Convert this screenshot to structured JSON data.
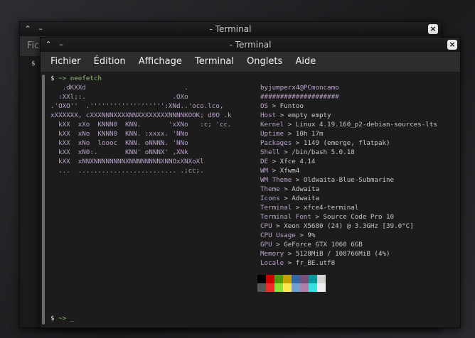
{
  "back_window": {
    "title": "- Terminal",
    "menu_partial": "Fic",
    "prompt_partial": "$"
  },
  "front_window": {
    "title": "- Terminal",
    "menu": [
      "Fichier",
      "Édition",
      "Affichage",
      "Terminal",
      "Onglets",
      "Aide"
    ],
    "prompt_symbol": "$",
    "prompt_arrow": "~>",
    "command": "neofetch",
    "final_prompt": "~> _"
  },
  "logo_lines": [
    "   .dKXXd                         .",
    "  :XXl;:.                      .OXo",
    ".'OXO''  .''''''''''''''''''':XNd..'oco.lco,",
    "xXXXXXX, cXXXNNNXXXXNNXXXXXXXXNNNNKOOK; d0O .k",
    "  kXX  xXo  KNNN0  KNN.       'xXNo   :c; 'cc.",
    "  kXX  xNo  KNNN0  KNN. :xxxx. 'NNo",
    "  kXX  xNo  loooc  KNN. oNNNN. 'NNo",
    "  kXX  xN0:.       KNN' oNNNX' ,XNk",
    "  kXX  xNNXNNNNNNNNXNNNNNNNNXNNOxXNXoXl",
    "  ...  ......................... .;cc;."
  ],
  "sysinfo": {
    "user_host": "byjumperx4@PCmoncamo",
    "separator": "####################",
    "rows": [
      {
        "key": "OS",
        "val": "Funtoo"
      },
      {
        "key": "Host",
        "val": "empty empty"
      },
      {
        "key": "Kernel",
        "val": "Linux 4.19.160_p2-debian-sources-lts"
      },
      {
        "key": "Uptime",
        "val": "10h 17m"
      },
      {
        "key": "Packages",
        "val": "1149 (emerge, flatpak)"
      },
      {
        "key": "Shell",
        "val": "/bin/bash 5.0.18"
      },
      {
        "key": "DE",
        "val": "Xfce 4.14"
      },
      {
        "key": "WM",
        "val": "Xfwm4"
      },
      {
        "key": "WM Theme",
        "val": "Oldwaita-Blue-Submarine"
      },
      {
        "key": "Theme",
        "val": "Adwaita"
      },
      {
        "key": "Icons",
        "val": "Adwaita"
      },
      {
        "key": "Terminal",
        "val": "xfce4-terminal"
      },
      {
        "key": "Terminal Font",
        "val": "Source Code Pro 10"
      },
      {
        "key": "CPU",
        "val": "Xeon X5680 (24) @ 3.3GHz [39.0°C]"
      },
      {
        "key": "CPU Usage",
        "val": "9%"
      },
      {
        "key": "GPU",
        "val": "GeForce GTX 1060 6GB"
      },
      {
        "key": "Memory",
        "val": "5128MiB / 108766MiB (4%)"
      },
      {
        "key": "Locale",
        "val": "fr_BE.utf8"
      }
    ],
    "row_sep": " > "
  },
  "colors": {
    "row1": [
      "#000000",
      "#cc0000",
      "#4e9a06",
      "#c4a000",
      "#3465a4",
      "#75507b",
      "#06989a",
      "#d3d7cf"
    ],
    "row2": [
      "#555753",
      "#ef2929",
      "#8ae234",
      "#fce94f",
      "#729fcf",
      "#ad7fa8",
      "#34e2e2",
      "#eeeeec"
    ]
  }
}
